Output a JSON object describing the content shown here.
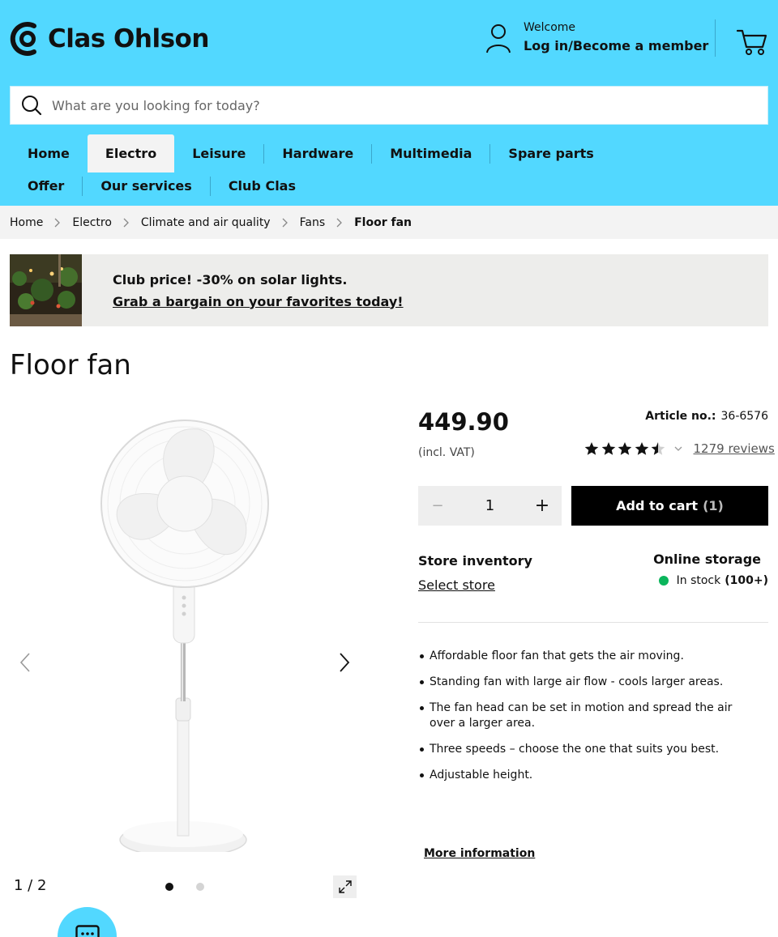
{
  "header": {
    "logo_text": "Clas Ohlson",
    "welcome": "Welcome",
    "login_label": "Log in/Become a member",
    "brand_color": "#52d8ff"
  },
  "search": {
    "placeholder": "What are you looking for today?",
    "value": ""
  },
  "nav": {
    "row1": [
      {
        "label": "Home",
        "active": false
      },
      {
        "label": "Electro",
        "active": true
      },
      {
        "label": "Leisure",
        "active": false
      },
      {
        "label": "Hardware",
        "active": false
      },
      {
        "label": "Multimedia",
        "active": false
      },
      {
        "label": "Spare parts",
        "active": false
      }
    ],
    "row2": [
      {
        "label": "Offer"
      },
      {
        "label": "Our services"
      },
      {
        "label": "Club Clas"
      }
    ]
  },
  "breadcrumb": [
    "Home",
    "Electro",
    "Climate and air quality",
    "Fans",
    "Floor fan"
  ],
  "promo": {
    "title": "Club price! -30% on solar lights.",
    "link": "Grab a bargain on your favorites today!"
  },
  "product": {
    "title": "Floor fan",
    "price": "449.90",
    "vat_note": "(incl. VAT)",
    "article_label": "Article no.:",
    "article_no": "36-6576",
    "rating": 4.5,
    "rating_max": 5,
    "reviews_label": "1279 reviews",
    "quantity": "1",
    "add_to_cart_label": "Add to cart",
    "cart_count": "(1)",
    "store_inventory_title": "Store inventory",
    "select_store_label": "Select store",
    "online_storage_title": "Online storage",
    "stock_status": "In stock",
    "stock_count": "(100+)",
    "stock_color": "#0bb55c",
    "features": [
      "Affordable floor fan that gets the air moving.",
      "Standing fan with large air flow - cools larger areas.",
      "The fan head can be set in motion and spread the air over a larger area.",
      "Three speeds – choose the one that suits you best.",
      "Adjustable height."
    ],
    "more_info_label": "More information"
  },
  "gallery": {
    "counter": "1 / 2",
    "current_image": 1,
    "total_images": 2
  },
  "icons": [
    "account-icon",
    "cart-icon",
    "search-icon",
    "chevron-right-icon",
    "chevron-left-icon",
    "star-icon",
    "chevron-down-icon",
    "expand-icon",
    "chat-icon"
  ]
}
